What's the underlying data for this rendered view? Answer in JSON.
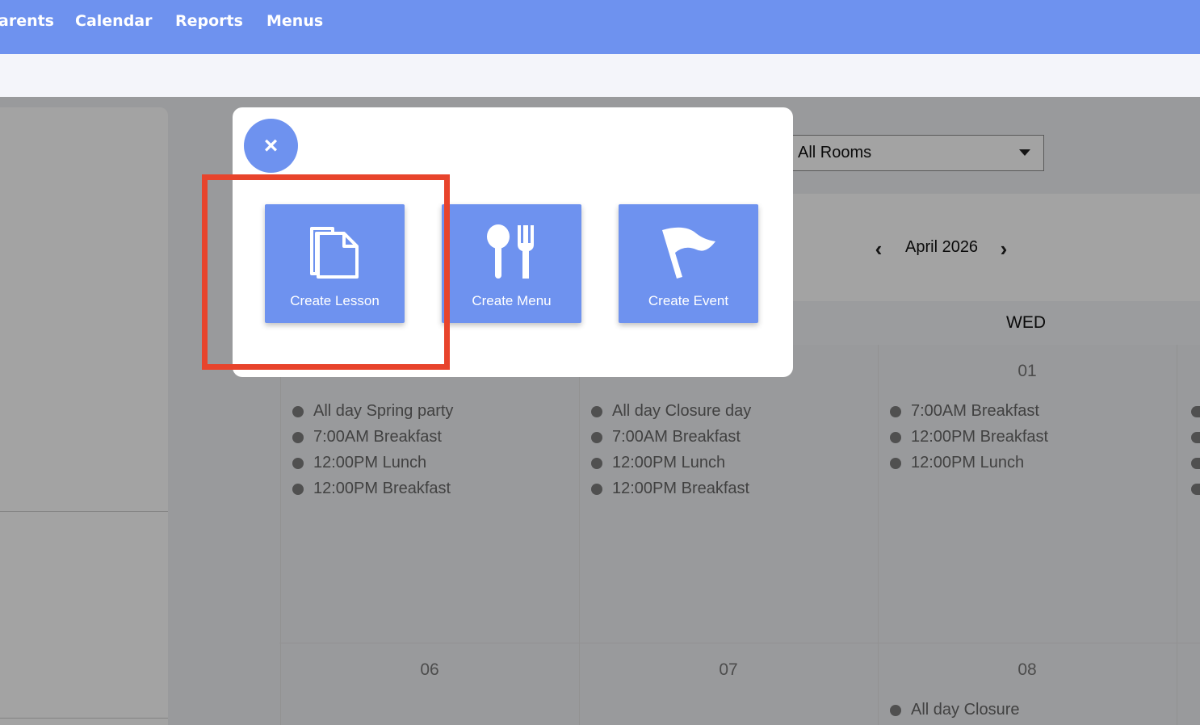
{
  "nav": {
    "items": [
      "arents",
      "Calendar",
      "Reports",
      "Menus"
    ]
  },
  "rooms_filter": {
    "selected": "All Rooms"
  },
  "calendar": {
    "month_label": "April 2026",
    "day_header": "WED",
    "week1": {
      "col1_events": [
        "All day Spring party",
        "7:00AM Breakfast",
        "12:00PM Lunch",
        "12:00PM Breakfast"
      ],
      "col2_events": [
        "All day Closure day",
        "7:00AM Breakfast",
        "12:00PM Lunch",
        "12:00PM Breakfast"
      ],
      "col3_date": "01",
      "col3_events": [
        "7:00AM Breakfast",
        "12:00PM Breakfast",
        "12:00PM Lunch"
      ]
    },
    "week2": {
      "col1_date": "06",
      "col2_date": "07",
      "col3_date": "08",
      "col3_events": [
        "All day Closure"
      ]
    }
  },
  "modal": {
    "close_label": "×",
    "actions": [
      {
        "label": "Create Lesson",
        "icon": "documents-icon"
      },
      {
        "label": "Create Menu",
        "icon": "utensils-icon"
      },
      {
        "label": "Create Event",
        "icon": "flag-icon"
      }
    ]
  },
  "colors": {
    "primary": "#6e92ef",
    "highlight": "#e8442c"
  }
}
